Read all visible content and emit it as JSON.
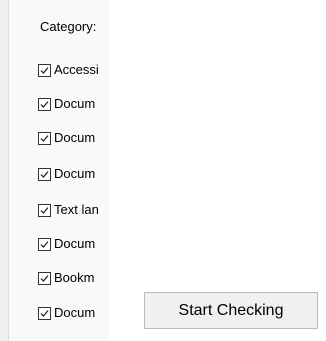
{
  "category": {
    "label": "Category:"
  },
  "checks": [
    {
      "label": "Accessi",
      "checked": true
    },
    {
      "label": "Docum",
      "checked": true
    },
    {
      "label": "Docum",
      "checked": true
    },
    {
      "label": "Docum",
      "checked": true
    },
    {
      "label": "Text lan",
      "checked": true
    },
    {
      "label": "Docum",
      "checked": true
    },
    {
      "label": "Bookm",
      "checked": true
    },
    {
      "label": "Docum",
      "checked": true
    }
  ],
  "actions": {
    "start_label": "Start Checking"
  },
  "icons": {
    "checkmark": "checkmark-icon"
  }
}
